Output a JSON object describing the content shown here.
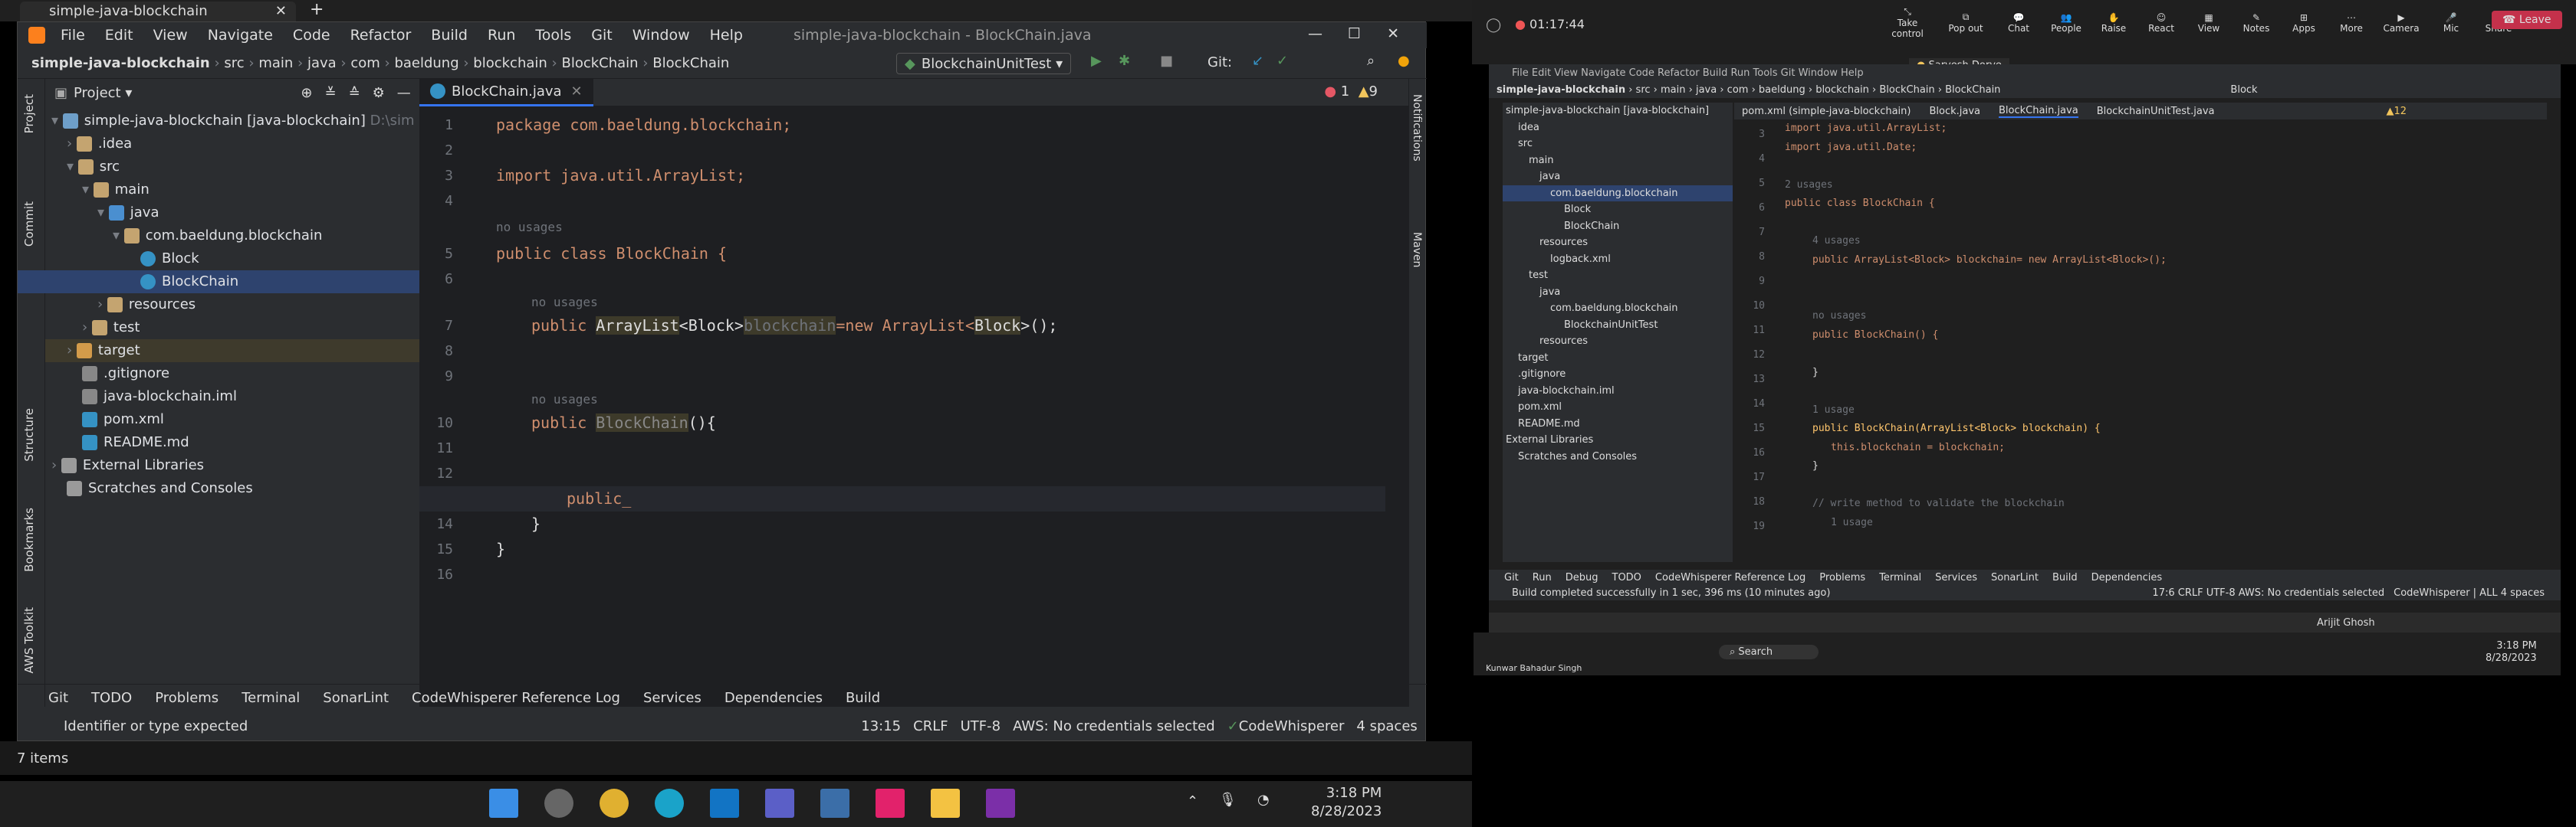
{
  "left_window": {
    "tab_title": "simple-java-blockchain",
    "title": "simple-java-blockchain - BlockChain.java",
    "menu": [
      "File",
      "Edit",
      "View",
      "Navigate",
      "Code",
      "Refactor",
      "Build",
      "Run",
      "Tools",
      "Git",
      "Window",
      "Help"
    ],
    "breadcrumb": [
      "simple-java-blockchain",
      "src",
      "main",
      "java",
      "com",
      "baeldung",
      "blockchain",
      "BlockChain",
      "BlockChain"
    ],
    "run_config": "BlockchainUnitTest",
    "git_label": "Git:",
    "project_label": "Project",
    "tree": [
      "simple-java-blockchain [java-blockchain]",
      "D:\\sim",
      "idea",
      ".idea",
      "src",
      "main",
      "java",
      "com.baeldung.blockchain",
      "Block",
      "BlockChain",
      "resources",
      "test",
      "target",
      ".gitignore",
      "java-blockchain.iml",
      "pom.xml",
      "README.md",
      "External Libraries",
      "Scratches and Consoles"
    ],
    "editor_tab": "BlockChain.java",
    "errors": "1",
    "warnings": "9",
    "lines": [
      "1",
      "2",
      "3",
      "4",
      "5",
      "6",
      "7",
      "8",
      "9",
      "10",
      "11",
      "12",
      "13",
      "14",
      "15",
      "16"
    ],
    "code": {
      "pkg": "package com.baeldung.blockchain;",
      "imp": "import java.util.ArrayList;",
      "nousage": "no usages",
      "cls": "public class BlockChain {",
      "field_pre": "public ",
      "field_type": "ArrayList",
      "field_gen": "<Block>",
      "field_name": "blockchain",
      "field_rest": "=new ArrayList<",
      "field_gen2": "Block",
      "field_end": ">();",
      "ctor_pre": "public ",
      "ctor": "BlockChain",
      "ctor_rest": "(){",
      "typing": "public_",
      "close1": "}",
      "close2": "}"
    },
    "bottom_tools": [
      "Git",
      "TODO",
      "Problems",
      "Terminal",
      "SonarLint",
      "CodeWhisperer Reference Log",
      "Services",
      "Dependencies",
      "Build"
    ],
    "status": {
      "msg": "Identifier or type expected",
      "pos": "13:15",
      "eol": "CRLF",
      "enc": "UTF-8",
      "aws": "AWS: No credentials selected",
      "cw": "CodeWhisperer",
      "indent": "4 spaces"
    },
    "items": "7 items",
    "side_tabs": [
      "Project",
      "Commit",
      "Structure",
      "Bookmarks",
      "AWS Toolkit"
    ],
    "right_tabs": [
      "Notifications",
      "Maven"
    ]
  },
  "meeting": {
    "timer": "01:17:44",
    "buttons": [
      "Take control",
      "Pop out",
      "Chat",
      "People",
      "Raise",
      "React",
      "View",
      "Notes",
      "Apps",
      "More",
      "Camera",
      "Mic",
      "Share"
    ],
    "leave": "Leave",
    "presenter": "Sarvesh Dorve",
    "self": "Arijit Ghosh",
    "other": "Kunwar Bahadur Singh"
  },
  "remote": {
    "breadcrumb": [
      "simple-java-blockchain",
      "src",
      "main",
      "java",
      "com",
      "baeldung",
      "blockchain",
      "BlockChain",
      "BlockChain"
    ],
    "tabs": [
      "pom.xml (simple-java-blockchain)",
      "Block.java",
      "BlockChain.java",
      "BlockchainUnitTest.java"
    ],
    "run": "Block",
    "tree": [
      "simple-java-blockchain [java-blockchain]",
      "idea",
      "src",
      "main",
      "java",
      "com.baeldung.blockchain",
      "Block",
      "BlockChain",
      "resources",
      "logback.xml",
      "test",
      "java",
      "com.baeldung.blockchain",
      "BlockchainUnitTest",
      "resources",
      "target",
      ".gitignore",
      "java-blockchain.iml",
      "pom.xml",
      "README.md",
      "External Libraries",
      "Scratches and Consoles"
    ],
    "lines": [
      "3",
      "4",
      "5",
      "6",
      "7",
      "8",
      "9",
      "10",
      "11",
      "12",
      "13",
      "14",
      "15",
      "16",
      "17",
      "18",
      "19"
    ],
    "code": [
      "import java.util.ArrayList;",
      "import java.util.Date;",
      "",
      "2 usages",
      "public class BlockChain {",
      "",
      "4 usages",
      "public ArrayList<Block> blockchain= new ArrayList<Block>();",
      "",
      "",
      "no usages",
      "public BlockChain() {",
      "",
      "}",
      "",
      "1 usage",
      "public BlockChain(ArrayList<Block> blockchain) {",
      "this.blockchain = blockchain;",
      "}",
      "",
      "// write method to validate the blockchain",
      "1 usage"
    ],
    "bottom": [
      "Git",
      "Run",
      "Debug",
      "TODO",
      "CodeWhisperer Reference Log",
      "Problems",
      "Terminal",
      "Services",
      "SonarLint",
      "Build",
      "Dependencies"
    ],
    "status": "Build completed successfully in 1 sec, 396 ms (10 minutes ago)",
    "status_right": "17:6  CRLF  UTF-8  AWS: No credentials selected",
    "status_cw": "CodeWhisperer | ALL  4 spaces",
    "warn": "12",
    "search": "Search",
    "time": "3:18 PM",
    "date": "8/28/2023"
  },
  "taskbar": {
    "time": "3:18 PM",
    "date": "8/28/2023"
  }
}
